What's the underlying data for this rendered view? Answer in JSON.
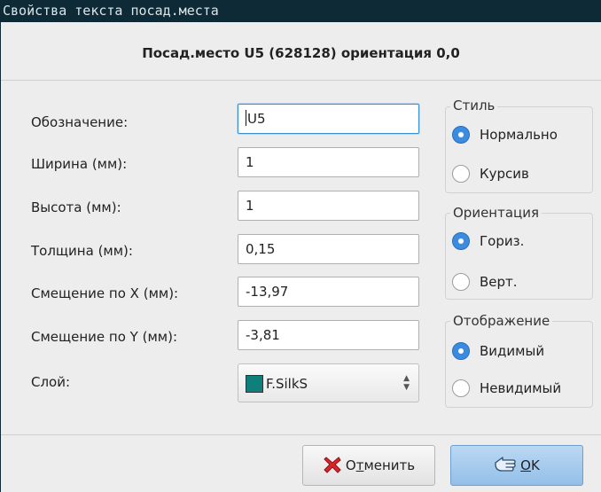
{
  "window": {
    "title": "Свойства текста посад.места"
  },
  "header": {
    "text": "Посад.место U5 (628128) ориентация 0,0"
  },
  "form": {
    "reference": {
      "label": "Обозначение:",
      "value": "U5"
    },
    "width": {
      "label": "Ширина (мм):",
      "value": "1"
    },
    "height": {
      "label": "Высота (мм):",
      "value": "1"
    },
    "thickness": {
      "label": "Толщина (мм):",
      "value": "0,15"
    },
    "offset_x": {
      "label": "Смещение по X (мм):",
      "value": "-13,97"
    },
    "offset_y": {
      "label": "Смещение по Y (мм):",
      "value": "-3,81"
    },
    "layer": {
      "label": "Слой:",
      "value": "F.SilkS",
      "swatch_color": "#0f7f7c"
    }
  },
  "style_group": {
    "title": "Стиль",
    "options": [
      "Нормально",
      "Курсив"
    ],
    "selected": "Нормально"
  },
  "orientation_group": {
    "title": "Ориентация",
    "options": [
      "Гориз.",
      "Верт."
    ],
    "selected": "Гориз."
  },
  "display_group": {
    "title": "Отображение",
    "options": [
      "Видимый",
      "Невидимый"
    ],
    "selected": "Видимый"
  },
  "buttons": {
    "cancel_prefix": "О",
    "cancel_underlined": "т",
    "cancel_rest": "менить",
    "ok_underlined": "O",
    "ok_rest": "K"
  },
  "colors": {
    "titlebar": "#0e2a36",
    "accent": "#3b8ce0",
    "ok_button": "#a8cdee"
  }
}
